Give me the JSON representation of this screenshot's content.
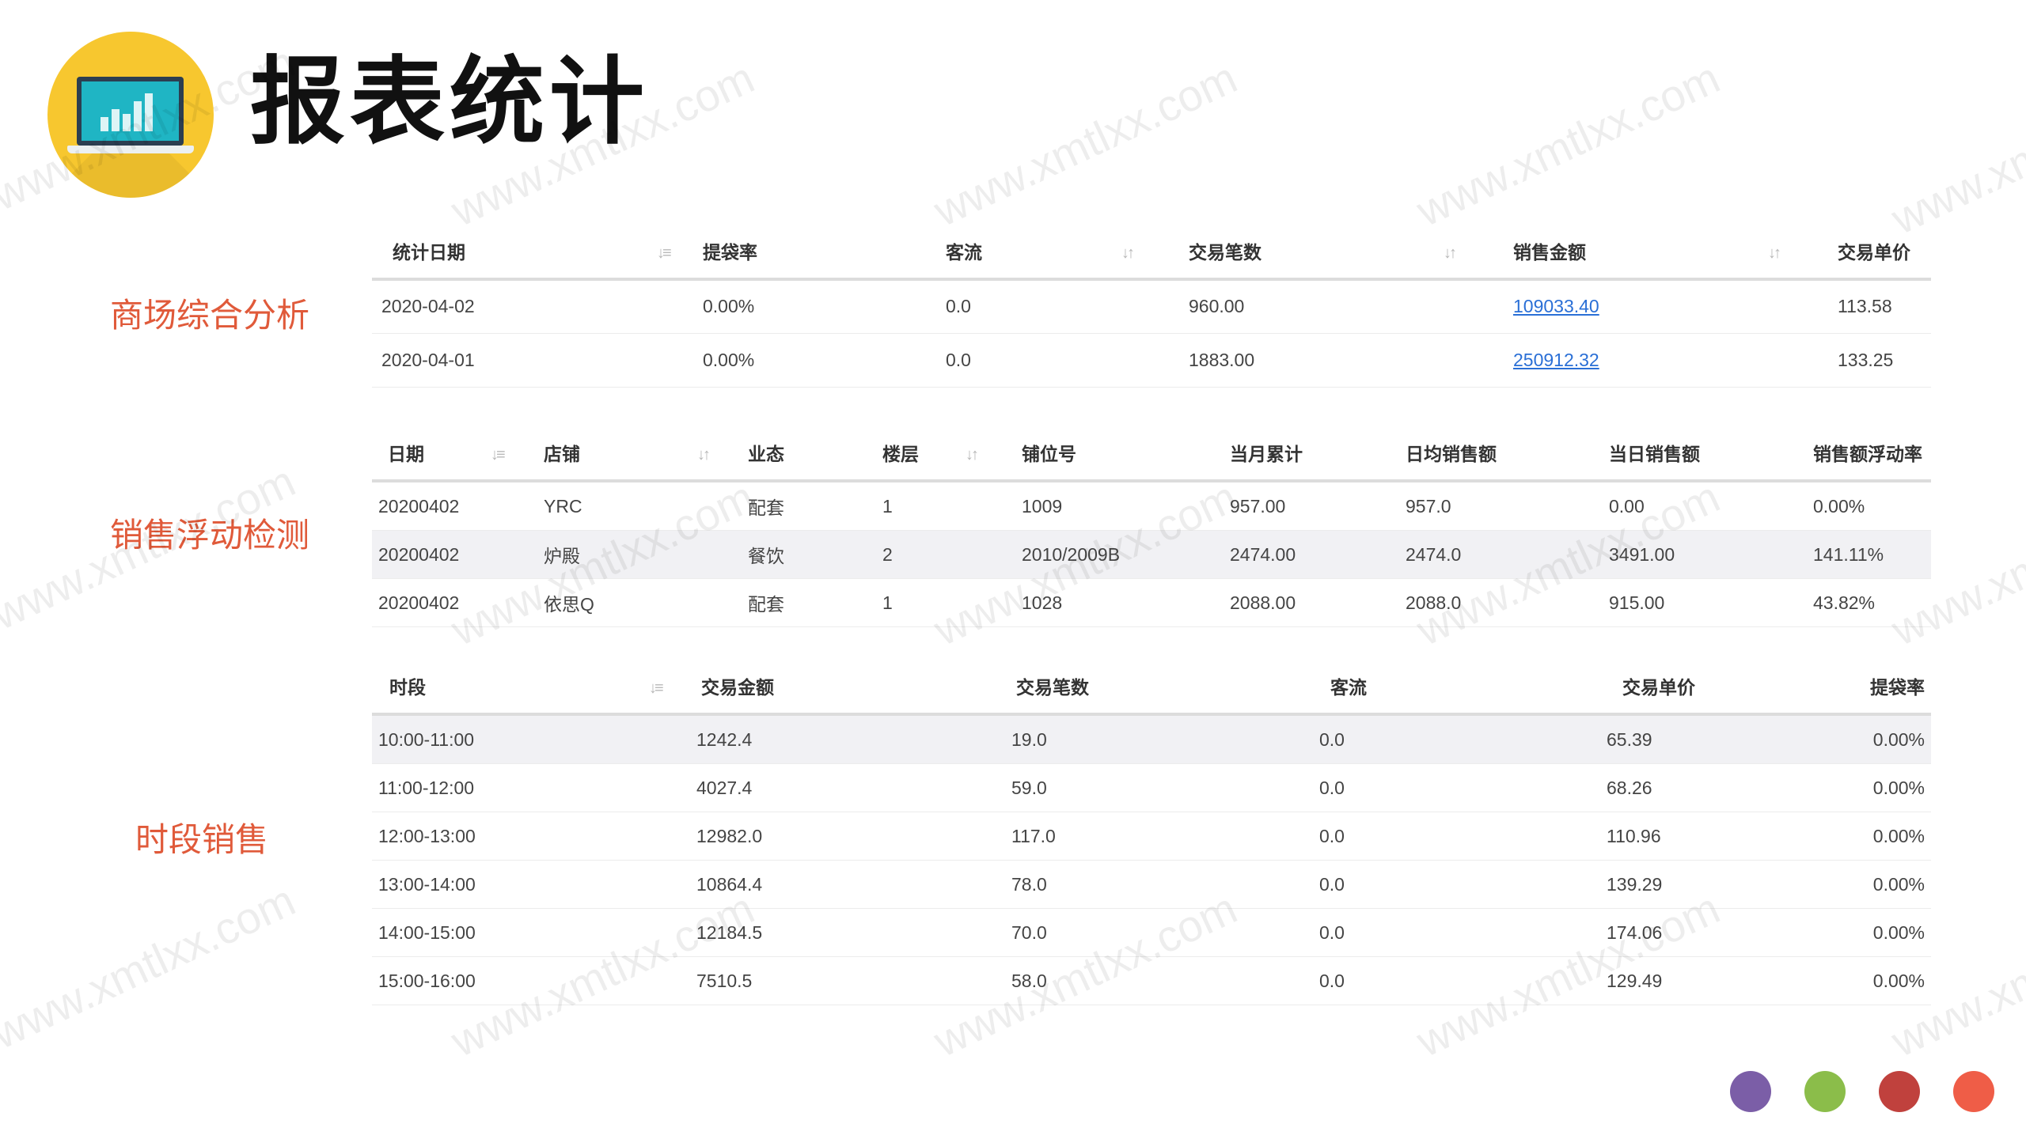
{
  "title": "报表统计",
  "sections": [
    {
      "label": "商场综合分析"
    },
    {
      "label": "销售浮动检测"
    },
    {
      "label": "时段销售"
    }
  ],
  "watermark": "www.xmtlxx.com",
  "table1": {
    "headers": [
      "统计日期",
      "提袋率",
      "客流",
      "交易笔数",
      "销售金额",
      "交易单价"
    ],
    "rows": [
      [
        "2020-04-02",
        "0.00%",
        "0.0",
        "960.00",
        "109033.40",
        "113.58"
      ],
      [
        "2020-04-01",
        "0.00%",
        "0.0",
        "1883.00",
        "250912.32",
        "133.25"
      ]
    ]
  },
  "table2": {
    "headers": [
      "日期",
      "店铺",
      "业态",
      "楼层",
      "铺位号",
      "当月累计",
      "日均销售额",
      "当日销售额",
      "销售额浮动率"
    ],
    "rows": [
      [
        "20200402",
        "YRC",
        "配套",
        "1",
        "1009",
        "957.00",
        "957.0",
        "0.00",
        "0.00%"
      ],
      [
        "20200402",
        "炉殿",
        "餐饮",
        "2",
        "2010/2009B",
        "2474.00",
        "2474.0",
        "3491.00",
        "141.11%"
      ],
      [
        "20200402",
        "依思Q",
        "配套",
        "1",
        "1028",
        "2088.00",
        "2088.0",
        "915.00",
        "43.82%"
      ]
    ]
  },
  "table3": {
    "headers": [
      "时段",
      "交易金额",
      "交易笔数",
      "客流",
      "交易单价",
      "提袋率"
    ],
    "rows": [
      [
        "10:00-11:00",
        "1242.4",
        "19.0",
        "0.0",
        "65.39",
        "0.00%"
      ],
      [
        "11:00-12:00",
        "4027.4",
        "59.0",
        "0.0",
        "68.26",
        "0.00%"
      ],
      [
        "12:00-13:00",
        "12982.0",
        "117.0",
        "0.0",
        "110.96",
        "0.00%"
      ],
      [
        "13:00-14:00",
        "10864.4",
        "78.0",
        "0.0",
        "139.29",
        "0.00%"
      ],
      [
        "14:00-15:00",
        "12184.5",
        "70.0",
        "0.0",
        "174.06",
        "0.00%"
      ],
      [
        "15:00-16:00",
        "7510.5",
        "58.0",
        "0.0",
        "129.49",
        "0.00%"
      ]
    ]
  },
  "colors": {
    "accent_label": "#e05a3a",
    "logo_circle": "#f7c72f",
    "link": "#2a6fd6",
    "dots": [
      "#7b5ea7",
      "#8bbd4a",
      "#c0413d",
      "#ef5d47"
    ]
  },
  "icons": {
    "logo": "laptop-chart-icon",
    "sort": "sort-arrows-icon"
  }
}
